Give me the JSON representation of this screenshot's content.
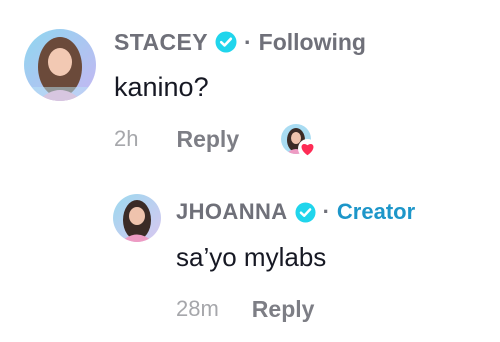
{
  "comment": {
    "username": "STACEY",
    "relation": "Following",
    "text": "kanino?",
    "time": "2h",
    "reply_label": "Reply"
  },
  "reply": {
    "username": "JHOANNA",
    "role": "Creator",
    "text": "sa’yo mylabs",
    "time": "28m",
    "reply_label": "Reply"
  },
  "separator": "·",
  "icons": {
    "verified": "verified-check-icon",
    "heart": "heart-icon"
  },
  "colors": {
    "creator": "#1d96c9",
    "verified": "#20d5ec",
    "heart": "#fe2c55"
  }
}
